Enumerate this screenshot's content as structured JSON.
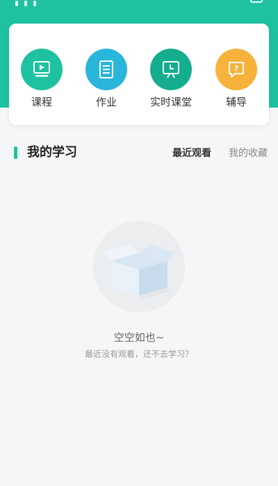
{
  "theme": {
    "header_color": "#1ec2a0",
    "course_color": "#1ec2a0",
    "homework_color": "#2ab5db",
    "live_color": "#14ad8d",
    "tutor_color": "#f7b23b"
  },
  "nav": [
    {
      "label": "课程",
      "icon": "video-screen-icon"
    },
    {
      "label": "作业",
      "icon": "document-icon"
    },
    {
      "label": "实时课堂",
      "icon": "clock-board-icon"
    },
    {
      "label": "辅导",
      "icon": "question-bubble-icon"
    }
  ],
  "section": {
    "title": "我的学习",
    "tabs": [
      {
        "label": "最近观看",
        "active": true
      },
      {
        "label": "我的收藏",
        "active": false
      }
    ]
  },
  "empty": {
    "title": "空空如也~",
    "subtitle": "最近没有观看，还不去学习？",
    "icon": "empty-box-icon"
  }
}
